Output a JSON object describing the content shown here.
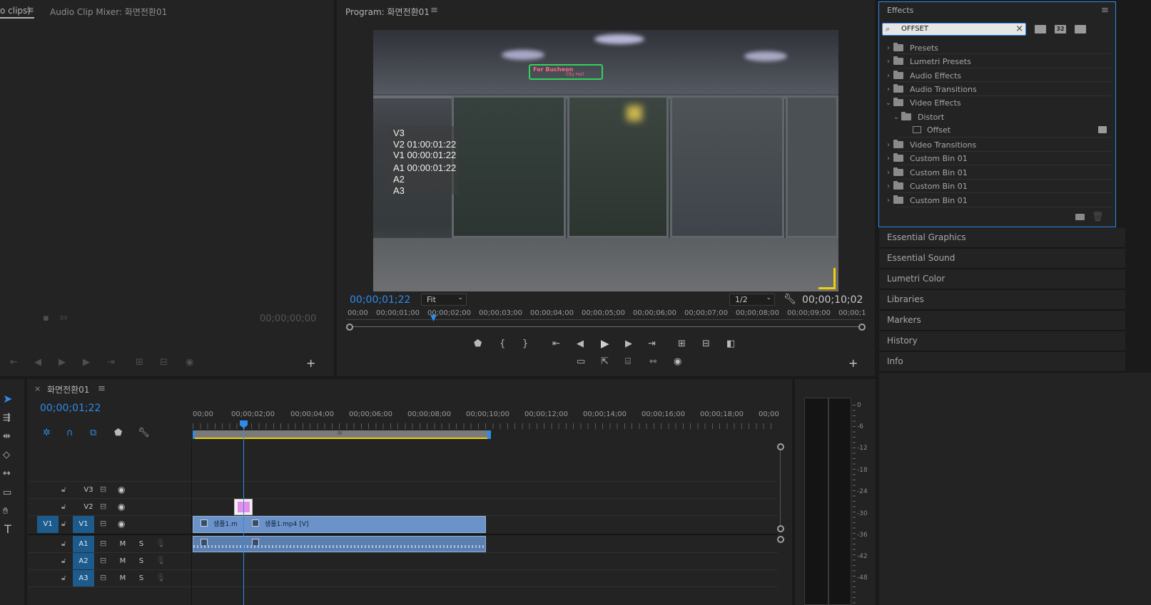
{
  "source_panel": {
    "tab_partial": "o clips)",
    "audio_mixer_tab": "Audio Clip Mixer: 화면전환01",
    "timecode": "00;00;00;00"
  },
  "program": {
    "title": "Program: 화면전환01",
    "timecode": "00;00;01;22",
    "fit": "Fit",
    "resolution": "1/2",
    "duration": "00;00;10;02",
    "overlay_lines": [
      "V3",
      "V2 01:00:01:22",
      "V1 00:00:01:22",
      "A1 00:00:01:22",
      "A2",
      "A3"
    ],
    "sign_text": "For Bucheon",
    "sign_sub": "City Hall",
    "ruler": [
      "00;00",
      "00;00;01;00",
      "00;00;02;00",
      "00;00;03;00",
      "00;00;04;00",
      "00;00;05;00",
      "00;00;06;00",
      "00;00;07;00",
      "00;00;08;00",
      "00;00;09;00",
      "00;00;1"
    ]
  },
  "effects": {
    "title": "Effects",
    "search_value": "OFFSET",
    "btn_accel": "32",
    "tree": [
      {
        "label": "Presets",
        "expanded": false
      },
      {
        "label": "Lumetri Presets",
        "expanded": false
      },
      {
        "label": "Audio Effects",
        "expanded": false
      },
      {
        "label": "Audio Transitions",
        "expanded": false
      },
      {
        "label": "Video Effects",
        "expanded": true
      },
      {
        "label": "Distort",
        "expanded": true
      },
      {
        "label": "Offset",
        "expanded": false
      },
      {
        "label": "Video Transitions",
        "expanded": false
      },
      {
        "label": "Custom Bin 01",
        "expanded": false
      },
      {
        "label": "Custom Bin 01",
        "expanded": false
      },
      {
        "label": "Custom Bin 01",
        "expanded": false
      },
      {
        "label": "Custom Bin 01",
        "expanded": false
      }
    ]
  },
  "side_panels": [
    "Essential Graphics",
    "Essential Sound",
    "Lumetri Color",
    "Libraries",
    "Markers",
    "History",
    "Info"
  ],
  "timeline": {
    "close": "×",
    "sequence_name": "화면전환01",
    "timecode": "00;00;01;22",
    "ruler": [
      "00;00",
      "00;00;02;00",
      "00;00;04;00",
      "00;00;06;00",
      "00;00;08;00",
      "00;00;10;00",
      "00;00;12;00",
      "00;00;14;00",
      "00;00;16;00",
      "00;00;18;00",
      "00;00"
    ],
    "tracks": {
      "v3": "V3",
      "v2": "V2",
      "v1_src": "V1",
      "v1": "V1",
      "a1": "A1",
      "a2": "A2",
      "a3": "A3",
      "mute": "M",
      "solo": "S"
    },
    "clips": {
      "v1_first": "샘플1.m",
      "v1_second": "샘플1.mp4 [V]"
    },
    "work_area_label": "III"
  },
  "meter": {
    "scale": [
      "0",
      "-6",
      "-12",
      "-18",
      "-24",
      "-30",
      "-36",
      "-42",
      "-48"
    ]
  },
  "tools": {
    "type": "T"
  },
  "colors": {
    "accent": "#2d8ceb",
    "clip_video": "#6b93c9",
    "clip_audio": "#5b7fae",
    "transition": "#e58ee8",
    "work_area": "#f1d100"
  }
}
